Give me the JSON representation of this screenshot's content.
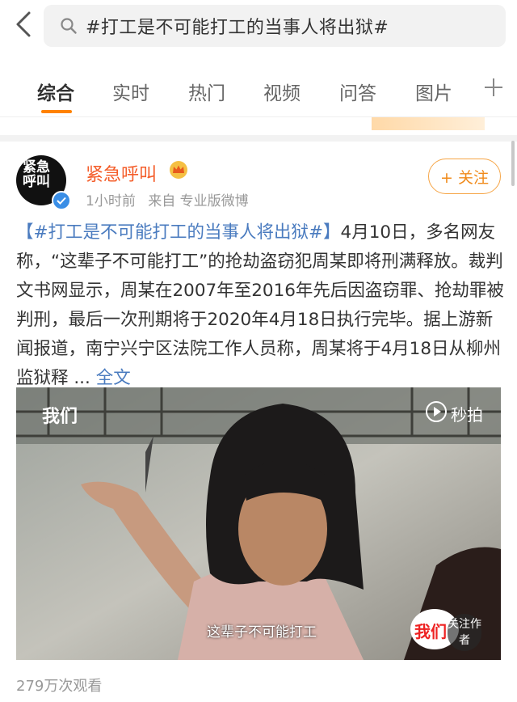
{
  "search": {
    "query": "#打工是不可能打工的当事人将出狱#"
  },
  "tabs": [
    {
      "label": "综合"
    },
    {
      "label": "实时"
    },
    {
      "label": "热门"
    },
    {
      "label": "视频"
    },
    {
      "label": "问答"
    },
    {
      "label": "图片"
    }
  ],
  "icons": {
    "back": "back-arrow-icon",
    "search": "search-icon",
    "plus": "plus-icon",
    "crown": "crown-badge-icon",
    "verified": "verified-badge-icon",
    "play": "play-icon"
  },
  "colors": {
    "accent": "#ff8200",
    "username": "#f45d2a",
    "link": "#4a7bbf",
    "follow": "#f08a1a"
  },
  "post": {
    "username": "紧急呼叫",
    "avatar_text": "紧急呼叫",
    "time": "1小时前",
    "source": "来自 专业版微博",
    "follow_label": "+ 关注",
    "hashtag": "【#打工是不可能打工的当事人将出狱#】",
    "body": "4月10日，多名网友称，“这辈子不可能打工”的抢劫盗窃犯周某即将刑满释放。裁判文书网显示，周某在2007年至2016年先后因盗窃罪、抢劫罪被判刑，最后一次刑期将于2020年4月18日执行完毕。据上游新闻报道，南宁兴宁区法院工作人员称，周某将于4月18日从柳州监狱释 ...",
    "fulltext": "全文",
    "video": {
      "watermark_left": "我们",
      "watermark_right": "秒拍",
      "subtitle": "这辈子不可能打工",
      "follow_logo": "我们",
      "follow_author": "关注作者"
    },
    "views": "279万次观看"
  }
}
